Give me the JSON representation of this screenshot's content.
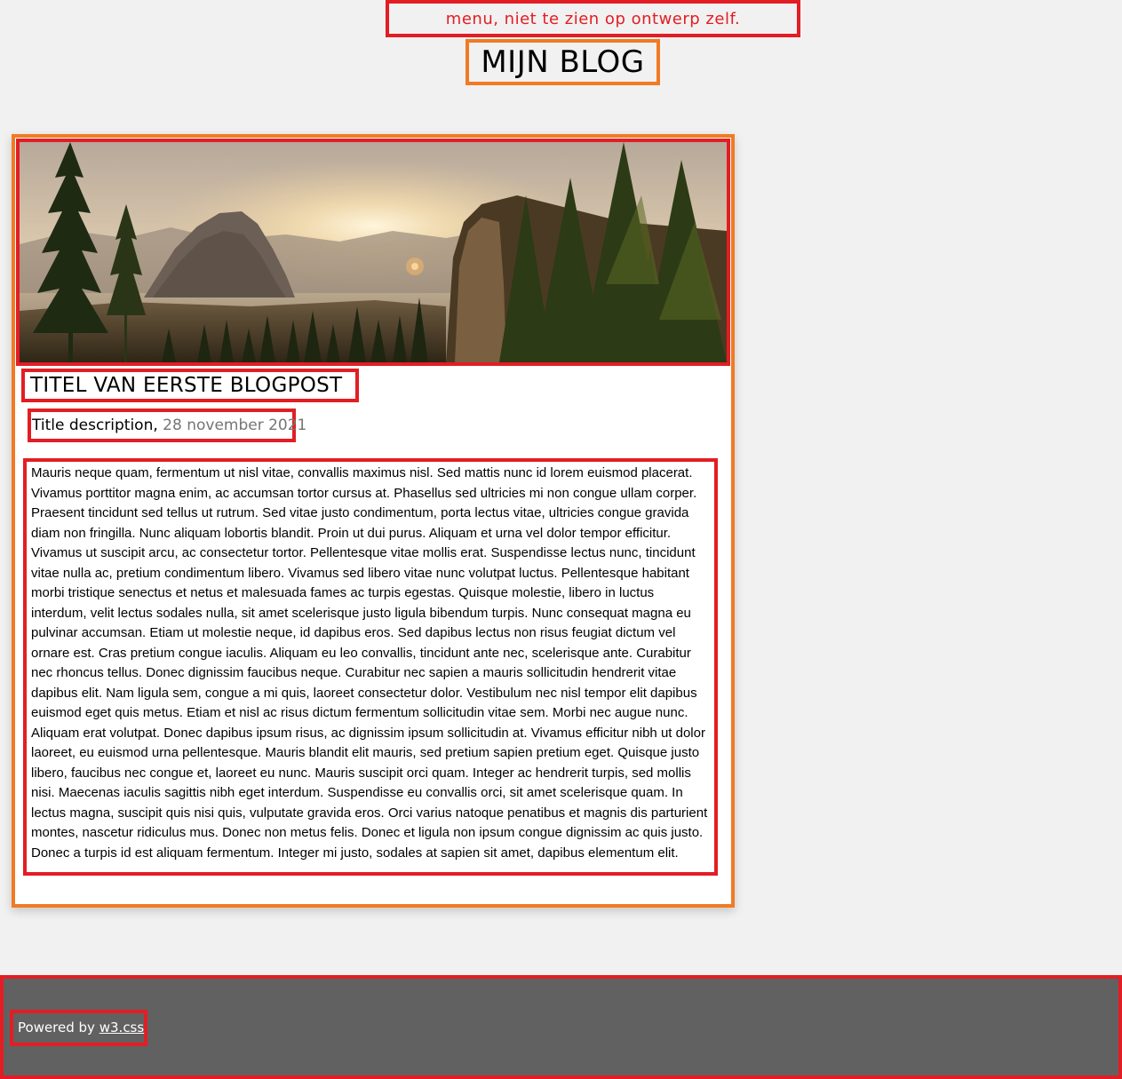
{
  "header": {
    "menu_note": "menu, niet te zien op ontwerp zelf.",
    "blog_title": "MIJN BLOG"
  },
  "post": {
    "title": "TITEL VAN EERSTE BLOGPOST",
    "description": "Title description,",
    "date": "28 november 2021",
    "image": "mountain-sunset-forest-landscape",
    "body": "Mauris neque quam, fermentum ut nisl vitae, convallis maximus nisl. Sed mattis nunc id lorem euismod placerat. Vivamus porttitor magna enim, ac accumsan tortor cursus at. Phasellus sed ultricies mi non congue ullam corper. Praesent tincidunt sed tellus ut rutrum. Sed vitae justo condimentum, porta lectus vitae, ultricies congue gravida diam non fringilla. Nunc aliquam lobortis blandit. Proin ut dui purus. Aliquam et urna vel dolor tempor efficitur. Vivamus ut suscipit arcu, ac consectetur tortor. Pellentesque vitae mollis erat. Suspendisse lectus nunc, tincidunt vitae nulla ac, pretium condimentum libero. Vivamus sed libero vitae nunc volutpat luctus. Pellentesque habitant morbi tristique senectus et netus et malesuada fames ac turpis egestas. Quisque molestie, libero in luctus interdum, velit lectus sodales nulla, sit amet scelerisque justo ligula bibendum turpis. Nunc consequat magna eu pulvinar accumsan. Etiam ut molestie neque, id dapibus eros. Sed dapibus lectus non risus feugiat dictum vel ornare est. Cras pretium congue iaculis. Aliquam eu leo convallis, tincidunt ante nec, scelerisque ante. Curabitur nec rhoncus tellus. Donec dignissim faucibus neque. Curabitur nec sapien a mauris sollicitudin hendrerit vitae dapibus elit. Nam ligula sem, congue a mi quis, laoreet consectetur dolor. Vestibulum nec nisl tempor elit dapibus euismod eget quis metus. Etiam et nisl ac risus dictum fermentum sollicitudin vitae sem. Morbi nec augue nunc. Aliquam erat volutpat. Donec dapibus ipsum risus, ac dignissim ipsum sollicitudin at. Vivamus efficitur nibh ut dolor laoreet, eu euismod urna pellentesque. Mauris blandit elit mauris, sed pretium sapien pretium eget. Quisque justo libero, faucibus nec congue et, laoreet eu nunc. Mauris suscipit orci quam. Integer ac hendrerit turpis, sed mollis nisi. Maecenas iaculis sagittis nibh eget interdum. Suspendisse eu convallis orci, sit amet scelerisque quam. In lectus magna, suscipit quis nisi quis, vulputate gravida eros. Orci varius natoque penatibus et magnis dis parturient montes, nascetur ridiculus mus. Donec non metus felis. Donec et ligula non ipsum congue dignissim ac quis justo. Donec a turpis id est aliquam fermentum. Integer mi justo, sodales at sapien sit amet, dapibus elementum elit."
  },
  "footer": {
    "powered_prefix": "Powered by",
    "powered_link": "w3.css"
  },
  "colors": {
    "page_bg": "#f1f1f1",
    "annotation_red": "#e31d24",
    "annotation_orange": "#f07b24",
    "footer_bg": "#616161",
    "date_grey": "#757575"
  }
}
